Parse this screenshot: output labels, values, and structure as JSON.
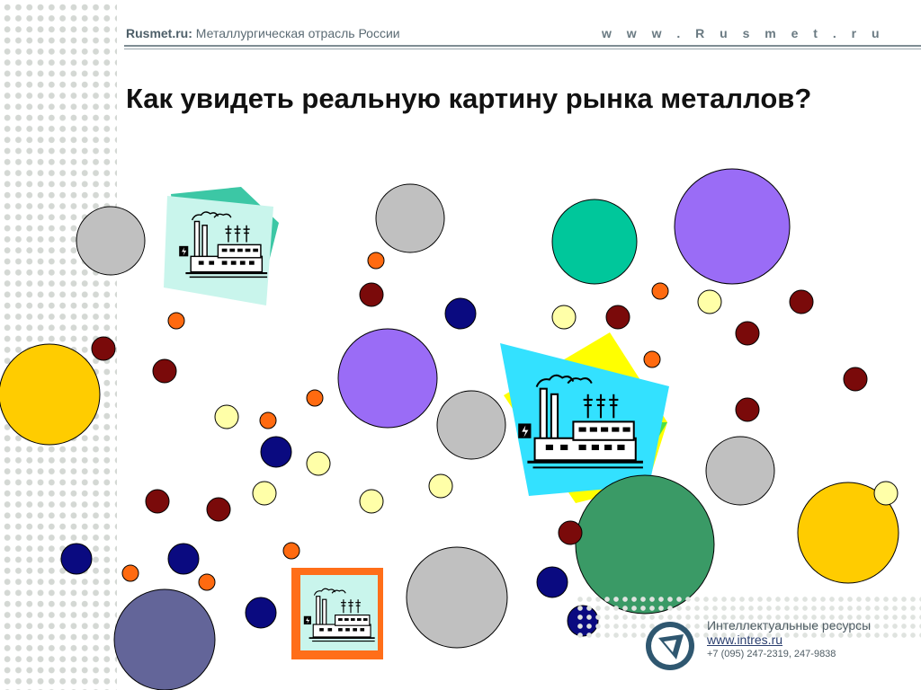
{
  "header": {
    "site_name": "Rusmet.ru:",
    "site_tagline": "Металлургическая отрасль России",
    "site_url": "w w w . R u s m e t . r u"
  },
  "slide": {
    "title": "Как увидеть реальную картину рынка металлов?"
  },
  "footer": {
    "org_name": "Интеллектуальные ресурсы",
    "org_url": "www.intres.ru",
    "org_phone": "+7 (095) 247-2319, 247-9838"
  },
  "colors": {
    "gray": "#c0c0c0",
    "violet": "#9a6cf6",
    "teal": "#00c79b",
    "gold": "#ffcc00",
    "darkgreen": "#3a9a66",
    "slate": "#636599",
    "navy": "#0a0a80",
    "maroon": "#7a0a0a",
    "orange": "#ff6a10",
    "paleyellow": "#ffffa8"
  },
  "icons": [
    "factory-icon",
    "factory-icon",
    "factory-icon",
    "intres-logo-icon"
  ]
}
